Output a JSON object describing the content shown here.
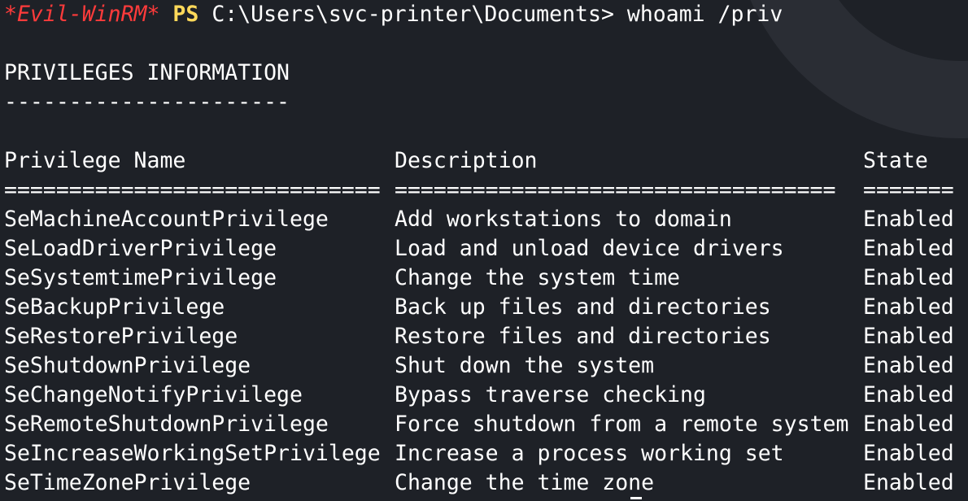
{
  "prompt": {
    "shell_tag": "*Evil-WinRM*",
    "ps": "PS",
    "path": "C:\\Users\\svc-printer\\Documents>",
    "command": "whoami /priv"
  },
  "section": {
    "title": "PRIVILEGES INFORMATION",
    "underline": "----------------------"
  },
  "table": {
    "headers": [
      "Privilege Name",
      "Description",
      "State"
    ],
    "separators": [
      "=============================",
      "==================================",
      "======="
    ],
    "rows": [
      [
        "SeMachineAccountPrivilege",
        "Add workstations to domain",
        "Enabled"
      ],
      [
        "SeLoadDriverPrivilege",
        "Load and unload device drivers",
        "Enabled"
      ],
      [
        "SeSystemtimePrivilege",
        "Change the system time",
        "Enabled"
      ],
      [
        "SeBackupPrivilege",
        "Back up files and directories",
        "Enabled"
      ],
      [
        "SeRestorePrivilege",
        "Restore files and directories",
        "Enabled"
      ],
      [
        "SeShutdownPrivilege",
        "Shut down the system",
        "Enabled"
      ],
      [
        "SeChangeNotifyPrivilege",
        "Bypass traverse checking",
        "Enabled"
      ],
      [
        "SeRemoteShutdownPrivilege",
        "Force shutdown from a remote system",
        "Enabled"
      ],
      [
        "SeIncreaseWorkingSetPrivilege",
        "Increase a process working set",
        "Enabled"
      ],
      [
        "SeTimeZonePrivilege",
        "Change the time zone",
        "Enabled"
      ]
    ]
  },
  "colors": {
    "background": "#1e2127",
    "shell_tag": "#ff3b3b",
    "ps": "#ffd95a",
    "text": "#ffffff"
  }
}
